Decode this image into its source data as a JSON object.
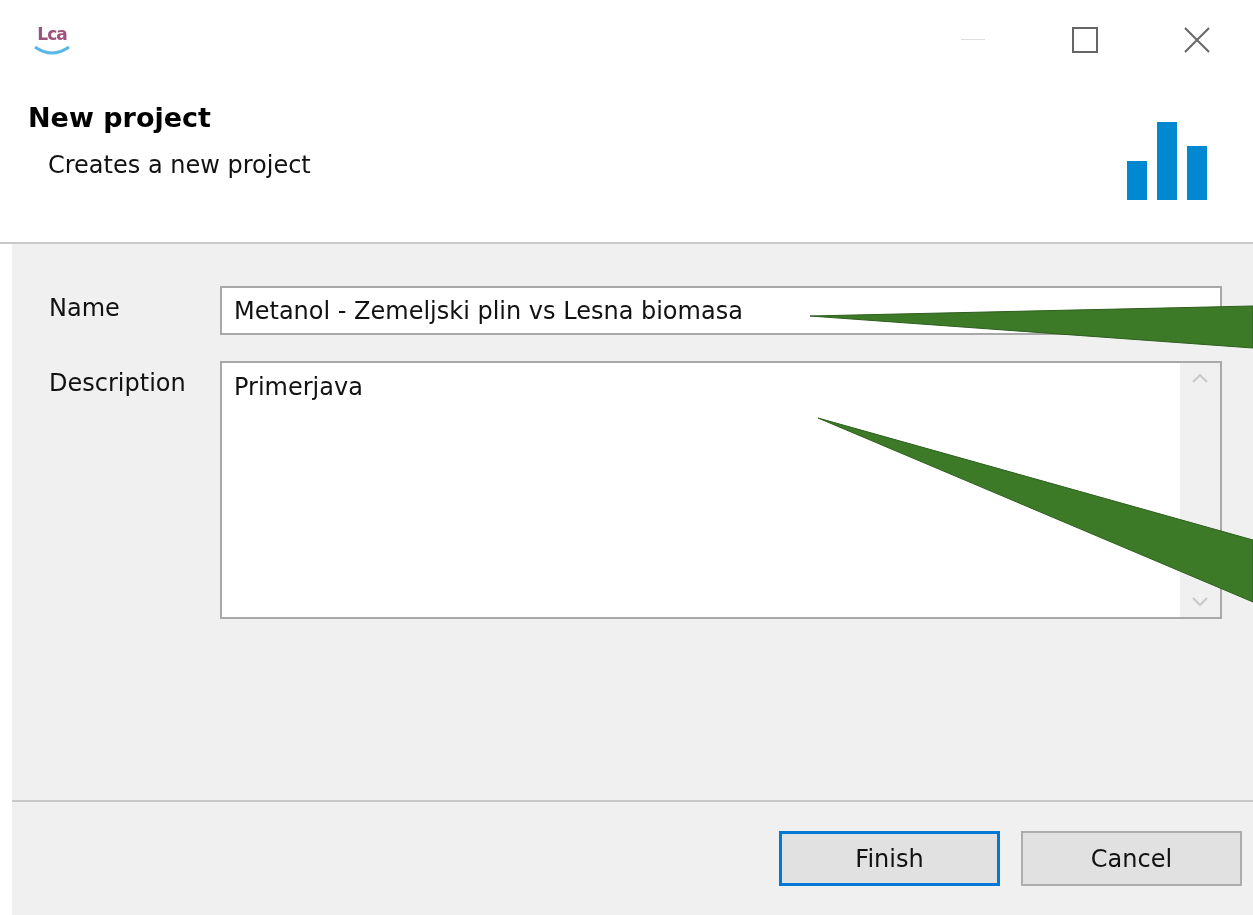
{
  "window": {
    "logo": "Lca",
    "title": "New project",
    "subtitle": "Creates a new project"
  },
  "fields": [
    {
      "kind": "line",
      "label": "Name",
      "value": "Metanol - Zemeljski plin vs Lesna biomasa"
    },
    {
      "kind": "multiline",
      "label": "Description",
      "value": "Primerjava"
    }
  ],
  "buttons": [
    {
      "label": "Finish",
      "selected": true
    },
    {
      "label": "Cancel",
      "selected": false
    }
  ]
}
